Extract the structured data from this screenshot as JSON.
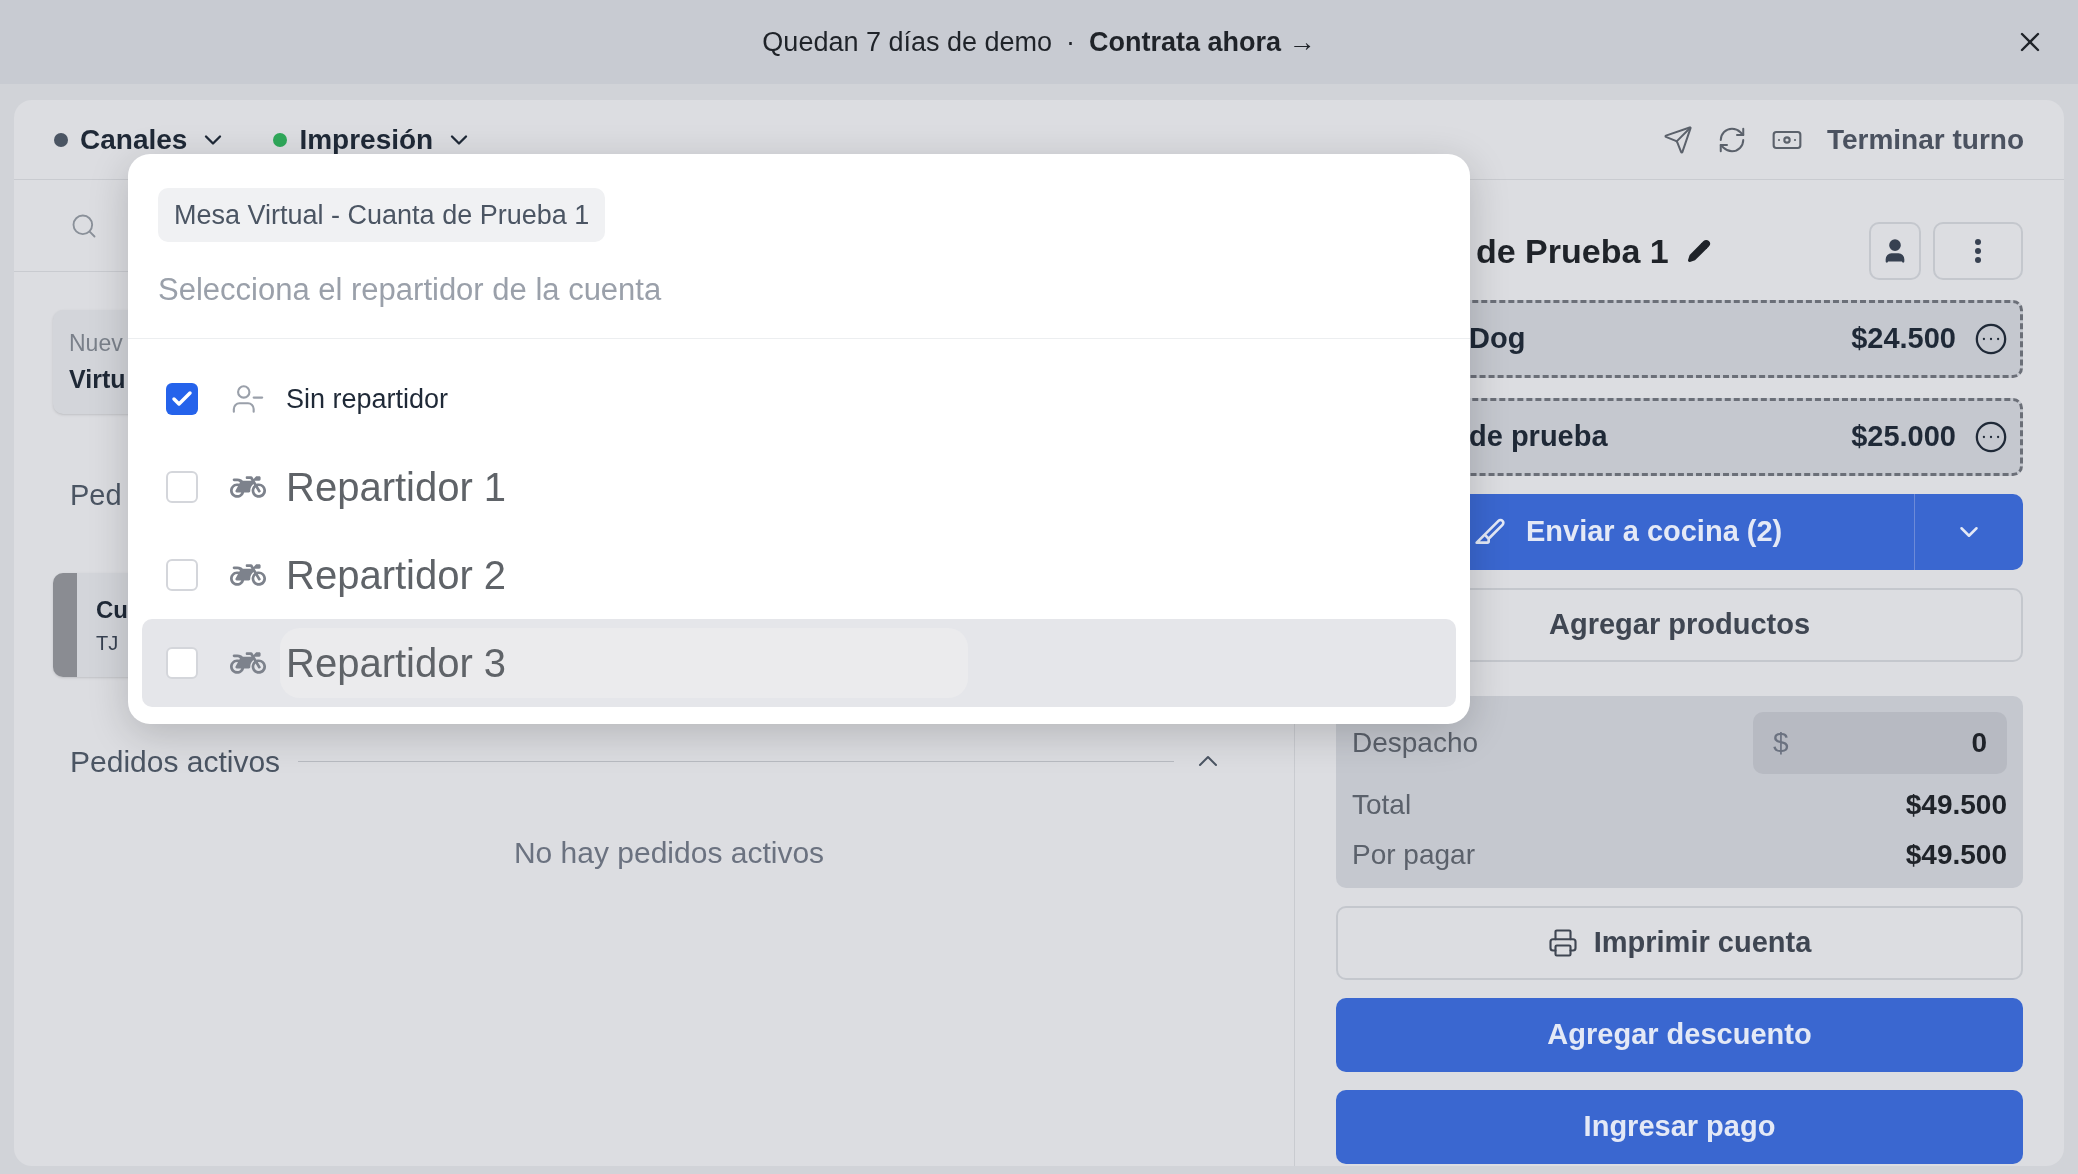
{
  "banner": {
    "text": "Quedan 7 días de demo",
    "separator": "·",
    "link": "Contrata ahora →"
  },
  "toolbar": {
    "menus": [
      {
        "label": "Canales",
        "color": "#4b5563"
      },
      {
        "label": "Impresión",
        "color": "#2fa85a"
      }
    ],
    "end_shift": "Terminar turno"
  },
  "left": {
    "cards": [
      {
        "title": "Nuev",
        "subtitle": "Virtu"
      }
    ],
    "section_fragment": "Ped",
    "orders": [
      {
        "title": "Cu",
        "subtitle": "TJ"
      }
    ],
    "active_orders": {
      "title": "Pedidos activos",
      "expanded": true,
      "empty": "No hay pedidos activos"
    }
  },
  "account": {
    "title": "de Prueba 1",
    "items": [
      {
        "name": "Dog",
        "price": "$24.500"
      },
      {
        "name": "de prueba",
        "price": "$25.000"
      }
    ],
    "send_button": "Enviar a cocina (2)",
    "add_products": "Agregar productos",
    "summary": {
      "shipping_label": "Despacho",
      "currency": "$",
      "shipping_value": "0",
      "total_label": "Total",
      "total": "$49.500",
      "due_label": "Por pagar",
      "due": "$49.500"
    },
    "print": "Imprimir cuenta",
    "discount": "Agregar descuento",
    "pay": "Ingresar pago"
  },
  "dialog": {
    "chip": "Mesa Virtual - Cuanta de Prueba 1",
    "placeholder": "Selecciona el repartidor de la cuenta",
    "options": [
      {
        "kind": "none",
        "label": "Sin repartidor",
        "checked": true,
        "highlighted": false
      },
      {
        "kind": "courier",
        "label": "Repartidor 1",
        "checked": false,
        "highlighted": false
      },
      {
        "kind": "courier",
        "label": "Repartidor 2",
        "checked": false,
        "highlighted": false
      },
      {
        "kind": "courier",
        "label": "Repartidor 3",
        "checked": false,
        "highlighted": true
      }
    ]
  }
}
